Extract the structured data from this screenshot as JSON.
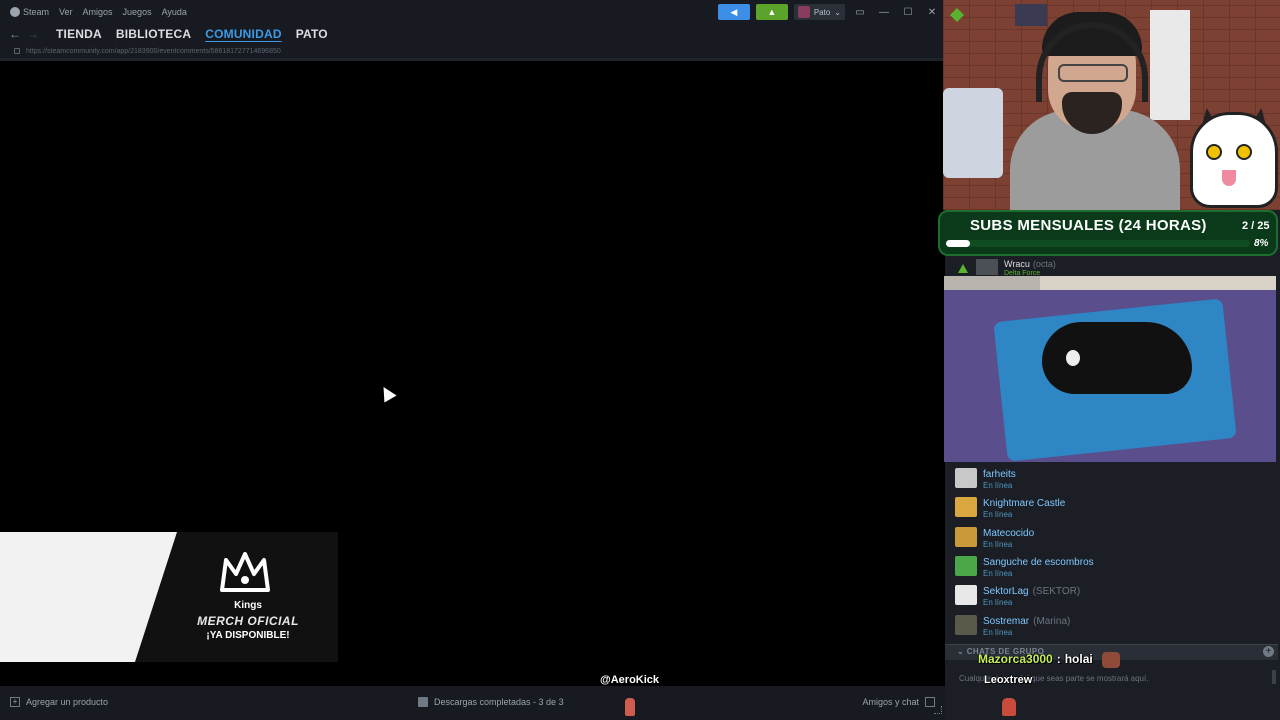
{
  "menubar": {
    "app": "Steam",
    "items": [
      "Ver",
      "Amigos",
      "Juegos",
      "Ayuda"
    ],
    "user": "Pato"
  },
  "nav": {
    "tabs": [
      "TIENDA",
      "BIBLIOTECA",
      "COMUNIDAD",
      "PATO"
    ],
    "active_tab": "COMUNIDAD",
    "url": "https://steamcommunity.com/app/2183900/eventcomments/586181727714696850"
  },
  "merch": {
    "brand": "Kings",
    "title": "MERCH OFICIAL",
    "subtitle": "¡YA DISPONIBLE!"
  },
  "statusbar": {
    "add_product": "Agregar un producto",
    "downloads": "Descargas completadas - 3 de 3",
    "friends_chat": "Amigos y chat"
  },
  "overlay": {
    "handle": "@AeroKick",
    "subs_title": "SUBS MENSUALES (24 HORAS)",
    "subs_count": "2 / 25",
    "subs_percent_label": "8%",
    "subs_fraction": 0.08
  },
  "friends_panel": {
    "partial_friend": {
      "name": "Wracu",
      "nick": "(octa)",
      "game": "Delta Force"
    },
    "friends": [
      {
        "name": "farheits",
        "nick": "",
        "status": "En línea",
        "avatar_color": "#c8c8c8"
      },
      {
        "name": "Knightmare Castle",
        "nick": "",
        "status": "En línea",
        "avatar_color": "#d9a640"
      },
      {
        "name": "Matecocido",
        "nick": "",
        "status": "En línea",
        "avatar_color": "#c99a3a"
      },
      {
        "name": "Sanguche de escombros",
        "nick": "",
        "status": "En línea",
        "avatar_color": "#4aa84a"
      },
      {
        "name": "SektorLag",
        "nick": "(SEKTOR)",
        "status": "En línea",
        "avatar_color": "#e8e8e8"
      },
      {
        "name": "Sostremar",
        "nick": "(Marina)",
        "status": "En línea",
        "avatar_color": "#5a5a4a"
      }
    ],
    "group_chats_title": "CHATS DE GRUPO",
    "group_chats_empty": "Cualquier grupo del que seas parte se mostrará aquí."
  },
  "chat": {
    "user": "Mazorca3000",
    "separator": ":",
    "message": "holai",
    "user2": "Leoxtrew"
  },
  "colors": {
    "steam_dark": "#171a21",
    "accent_blue": "#3d9ae6",
    "online_blue": "#4f94bc",
    "subs_green": "#0b3a1a"
  }
}
